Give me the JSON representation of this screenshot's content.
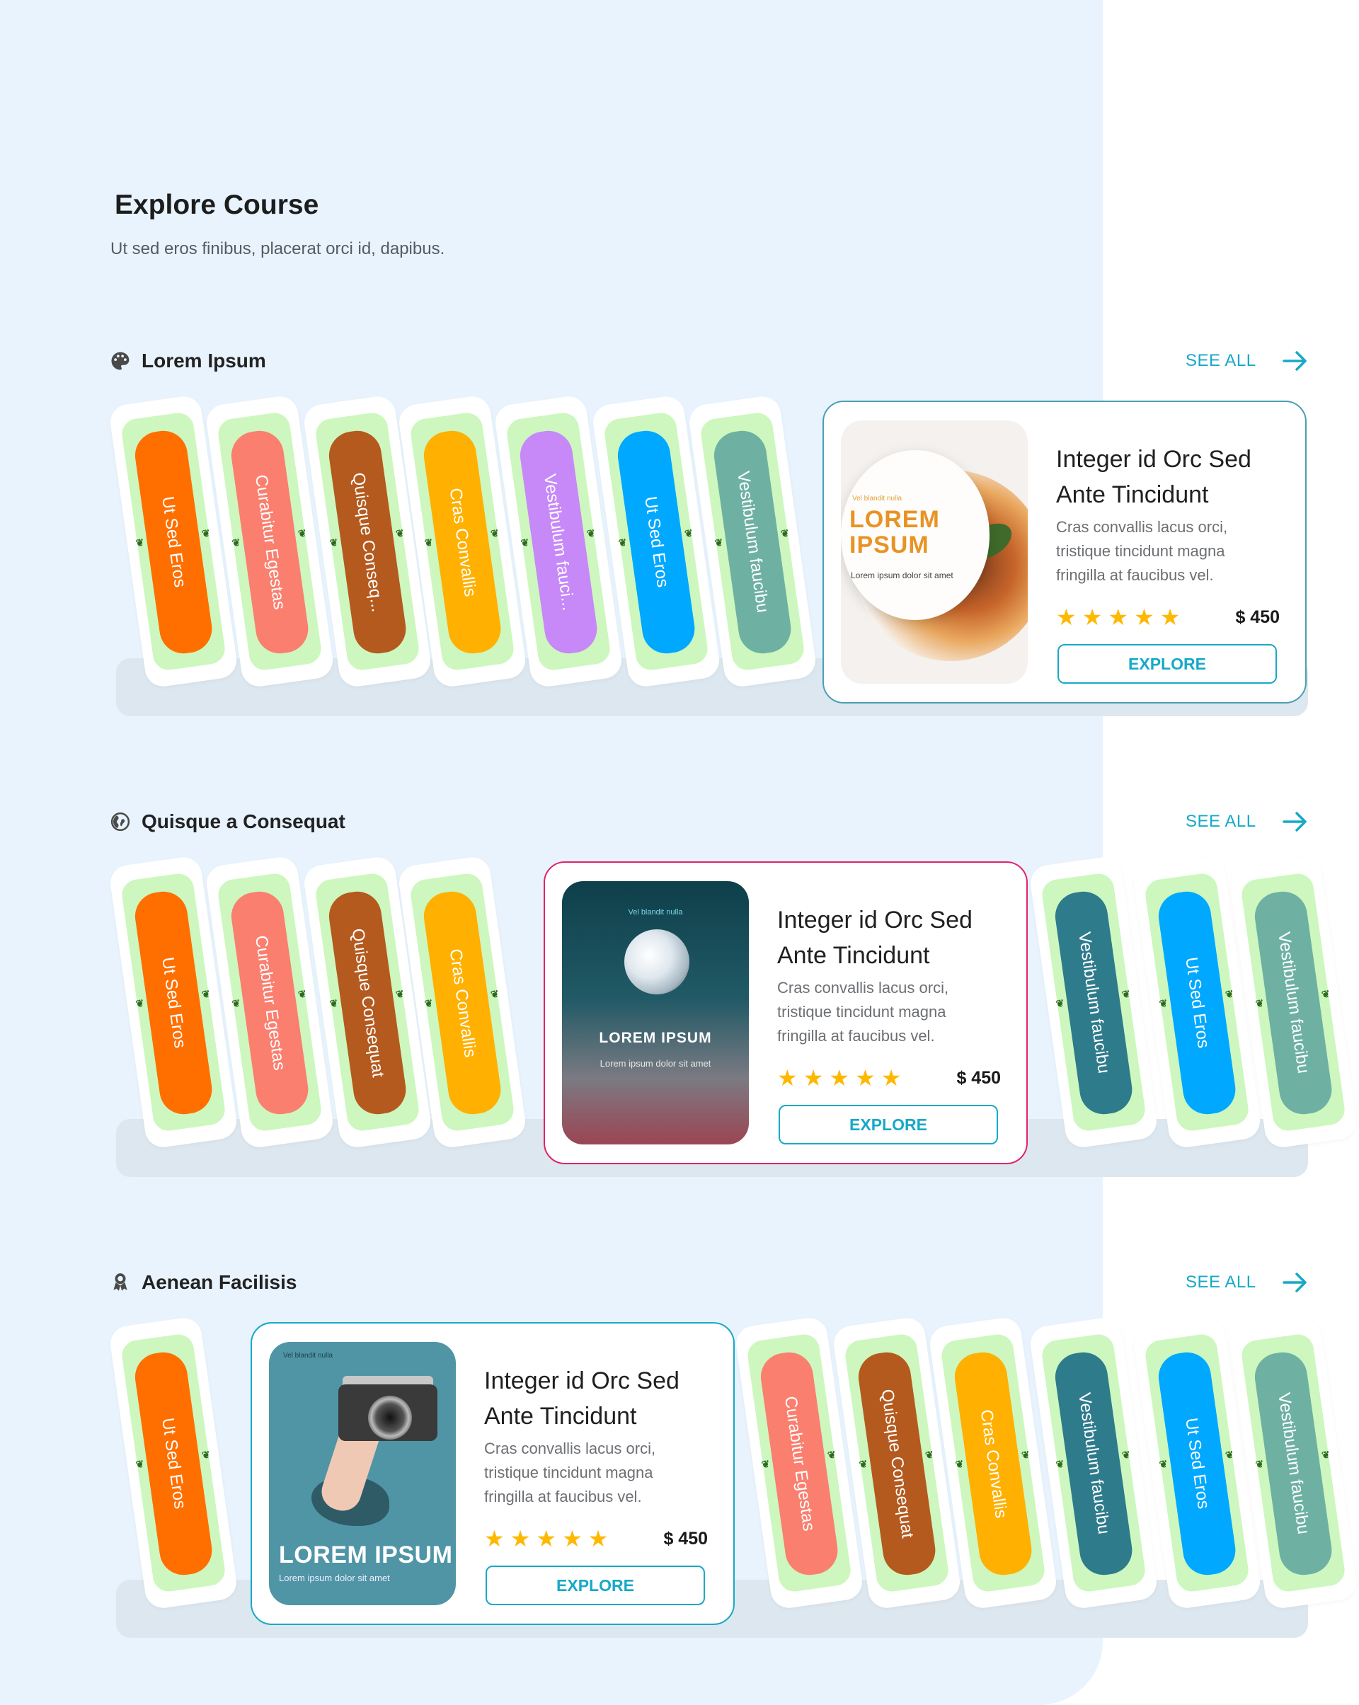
{
  "header": {
    "title": "Explore Course",
    "subtitle": "Ut sed eros finibus, placerat orci id, dapibus."
  },
  "colors": {
    "accent": "#17a9c7",
    "panel_bg": "#e8f3fe",
    "shelf": "#dde7ef",
    "book_wrap": "#cdf7be",
    "star": "#ffb800"
  },
  "see_all_label": "SEE ALL",
  "sections": [
    {
      "title": "Lorem Ipsum",
      "icon": "palette-icon",
      "books": [
        {
          "label": "Ut Sed Eros",
          "color": "#ff6f00"
        },
        {
          "label": "Curabitur Egestas",
          "color": "#fa7f6f"
        },
        {
          "label": "Quisque Conseq...",
          "color": "#b45a1e"
        },
        {
          "label": "Cras Convallis",
          "color": "#ffb000"
        },
        {
          "label": "Vestibulum fauci...",
          "color": "#c788f8"
        },
        {
          "label": "Ut Sed Eros",
          "color": "#00a8ff"
        },
        {
          "label": "Vestibulum faucibu",
          "color": "#6eb1a3"
        }
      ],
      "card": {
        "title": "Integer id Orc Sed Ante Tincidunt",
        "description": "Cras convallis lacus orci, tristique tincidunt magna fringilla at faucibus vel.",
        "rating": 5,
        "price": "$ 450",
        "button": "EXPLORE",
        "border": "#4aa0b4",
        "thumb": {
          "small": "Vel blandit nulla",
          "big": "LOREM IPSUM",
          "sub": "Lorem ipsum dolor sit amet"
        }
      }
    },
    {
      "title": "Quisque a Consequat",
      "icon": "globe-icon",
      "books_left": [
        {
          "label": "Ut Sed Eros",
          "color": "#ff6f00"
        },
        {
          "label": "Curabitur Egestas",
          "color": "#fa7f6f"
        },
        {
          "label": "Quisque Consequat",
          "color": "#b45a1e"
        },
        {
          "label": "Cras Convallis",
          "color": "#ffb000"
        }
      ],
      "books_right": [
        {
          "label": "Vestibulum faucibu",
          "color": "#2e7b8c"
        },
        {
          "label": "Ut Sed Eros",
          "color": "#00a8ff"
        },
        {
          "label": "Vestibulum faucibu",
          "color": "#6eb1a3"
        }
      ],
      "card": {
        "title": "Integer id Orc Sed Ante Tincidunt",
        "description": "Cras convallis lacus orci, tristique tincidunt magna fringilla at faucibus vel.",
        "rating": 5,
        "price": "$ 450",
        "button": "EXPLORE",
        "border": "#e0246a",
        "thumb": {
          "small": "Vel blandit nulla",
          "big": "LOREM IPSUM",
          "sub": "Lorem ipsum dolor sit amet"
        }
      }
    },
    {
      "title": "Aenean Facilisis",
      "icon": "award-icon",
      "books_left": [
        {
          "label": "Ut Sed Eros",
          "color": "#ff6f00"
        }
      ],
      "books_right": [
        {
          "label": "Curabitur Egestas",
          "color": "#fa7f6f"
        },
        {
          "label": "Quisque Consequat",
          "color": "#b45a1e"
        },
        {
          "label": "Cras Convallis",
          "color": "#ffb000"
        },
        {
          "label": "Vestibulum faucibu",
          "color": "#2e7b8c"
        },
        {
          "label": "Ut Sed Eros",
          "color": "#00a8ff"
        },
        {
          "label": "Vestibulum faucibu",
          "color": "#6eb1a3"
        }
      ],
      "card": {
        "title": "Integer id Orc Sed Ante Tincidunt",
        "description": "Cras convallis lacus orci, tristique tincidunt magna fringilla at faucibus vel.",
        "rating": 5,
        "price": "$ 450",
        "button": "EXPLORE",
        "border": "#17a9c7",
        "thumb": {
          "small": "Vel blandit nulla",
          "big": "LOREM IPSUM",
          "sub": "Lorem ipsum dolor sit amet"
        }
      }
    }
  ]
}
